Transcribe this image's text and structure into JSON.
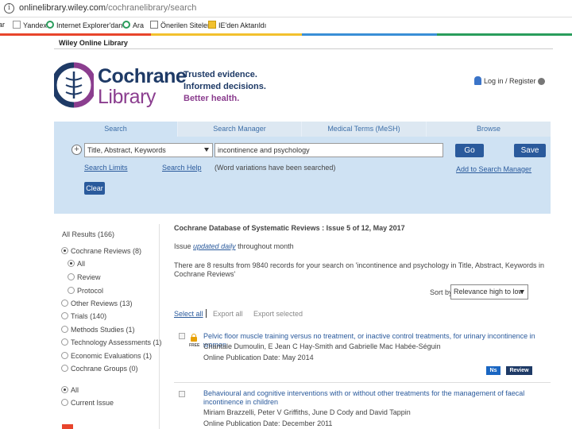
{
  "browser": {
    "url_host": "onlinelibrary.wiley.com",
    "url_path": "/cochranelibrary/search",
    "bookmarks": [
      {
        "label": "ar",
        "icon": "folder-icon"
      },
      {
        "label": "Yandex",
        "icon": "yandex-icon"
      },
      {
        "label": "Internet Explorer'dan",
        "icon": "search-icon"
      },
      {
        "label": "Ara",
        "icon": "search-icon"
      },
      {
        "label": "Önerilen Siteler",
        "icon": "page-icon"
      },
      {
        "label": "IE'den Aktarıldı",
        "icon": "folder-icon"
      }
    ],
    "strip_colors": [
      "#e8452c",
      "#f2c12e",
      "#3a8fd6",
      "#2a9d5c"
    ]
  },
  "header": {
    "wiley_label": "Wiley Online Library",
    "brand_line1": "Cochrane",
    "brand_line2": "Library",
    "tagline": [
      "Trusted evidence.",
      "Informed decisions.",
      "Better health."
    ],
    "login_label": "Log in / Register"
  },
  "search": {
    "tabs": [
      "Search",
      "Search Manager",
      "Medical Terms (MeSH)",
      "Browse"
    ],
    "active_tab": "Search",
    "field_select": "Title, Abstract, Keywords",
    "query": "incontinence and psychology",
    "go_label": "Go",
    "save_label": "Save",
    "search_limits": "Search Limits",
    "search_help": "Search Help",
    "variations_note": "(Word variations have been searched)",
    "add_manager": "Add to Search Manager",
    "clear_label": "Clear"
  },
  "filters": {
    "items": [
      {
        "label": "All Results (166)",
        "radio": false,
        "indent": 0
      },
      {
        "label": "Cochrane Reviews (8)",
        "radio": true,
        "checked": true,
        "indent": 0
      },
      {
        "label": "All",
        "radio": true,
        "checked": true,
        "indent": 1
      },
      {
        "label": "Review",
        "radio": true,
        "checked": false,
        "indent": 1
      },
      {
        "label": "Protocol",
        "radio": true,
        "checked": false,
        "indent": 1
      },
      {
        "label": "Other Reviews (13)",
        "radio": true,
        "checked": false,
        "indent": 0
      },
      {
        "label": "Trials (140)",
        "radio": true,
        "checked": false,
        "indent": 0
      },
      {
        "label": "Methods Studies (1)",
        "radio": true,
        "checked": false,
        "indent": 0
      },
      {
        "label": "Technology Assessments (1)",
        "radio": true,
        "checked": false,
        "indent": 0
      },
      {
        "label": "Economic Evaluations (1)",
        "radio": true,
        "checked": false,
        "indent": 0
      },
      {
        "label": "Cochrane Groups (0)",
        "radio": true,
        "checked": false,
        "indent": 0
      }
    ],
    "issue_options": [
      {
        "label": "All",
        "checked": true
      },
      {
        "label": "Current Issue",
        "checked": false
      }
    ]
  },
  "results": {
    "db_title": "Cochrane Database of Systematic Reviews : Issue 5 of 12, May 2017",
    "issue_prefix": "Issue",
    "issue_link": "updated daily",
    "issue_suffix": "throughout month",
    "summary": "There are 8 results from 9840 records for your search on 'incontinence and psychology in Title, Abstract, Keywords in Cochrane Reviews'",
    "sort_label": "Sort by",
    "sort_value": "Relevance high to low",
    "select_all": "Select all",
    "export_all": "Export all",
    "export_selected": "Export selected",
    "free_label": "FREE",
    "items": [
      {
        "title": "Pelvic floor muscle training versus no treatment, or inactive control treatments, for urinary incontinence in women",
        "authors": "Chantale Dumoulin, E Jean C Hay-Smith and Gabrielle Mac Habée-Séguin",
        "date": "Online Publication Date: May 2014",
        "badges": [
          {
            "label": "Ns",
            "color": "#1a66c2"
          },
          {
            "label": "Review",
            "color": "#1e3a66"
          }
        ]
      },
      {
        "title": "Behavioural and cognitive interventions with or without other treatments for the management of faecal incontinence in children",
        "authors": "Miriam Brazzelli, Peter V Griffiths, June D Cody and David Tappin",
        "date": "Online Publication Date: December 2011",
        "badges": []
      }
    ]
  },
  "colors": {
    "panel": "#cfe2f3",
    "brand_blue": "#1e3a66",
    "brand_purple": "#8b3e8f",
    "button_blue": "#2a5a9c"
  }
}
